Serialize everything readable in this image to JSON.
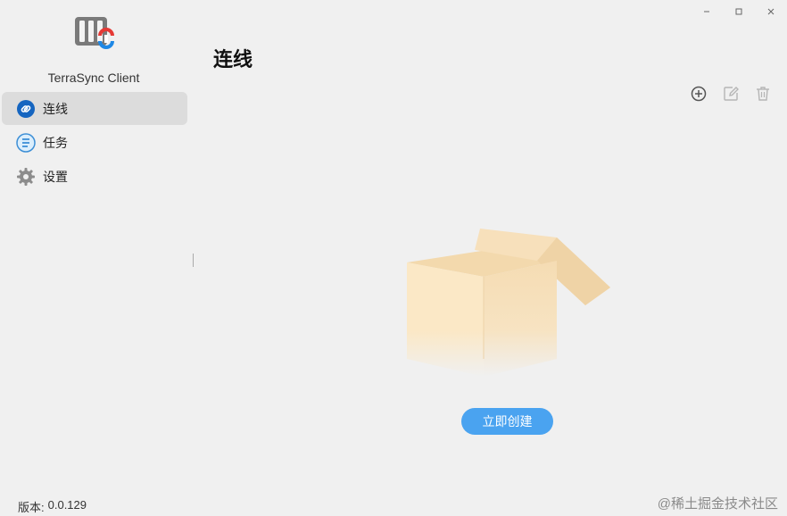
{
  "app": {
    "name": "TerraSync Client"
  },
  "window_controls": [
    {
      "name": "minimize",
      "icon": "minimize-icon"
    },
    {
      "name": "maximize",
      "icon": "maximize-icon"
    },
    {
      "name": "close",
      "icon": "close-icon"
    }
  ],
  "sidebar": {
    "items": [
      {
        "label": "连线",
        "icon": "link-icon",
        "active": true
      },
      {
        "label": "任务",
        "icon": "task-list-icon",
        "active": false
      },
      {
        "label": "设置",
        "icon": "gear-icon",
        "active": false
      }
    ],
    "version_label": "版本:",
    "version_value": "0.0.129"
  },
  "main": {
    "title": "连线",
    "toolbar": [
      {
        "name": "add",
        "icon": "add-circle-icon"
      },
      {
        "name": "edit",
        "icon": "edit-icon"
      },
      {
        "name": "delete",
        "icon": "trash-icon"
      }
    ],
    "empty_state": {
      "illustration": "empty-box-icon",
      "create_label": "立即创建"
    }
  },
  "watermark": "@稀土掘金技术社区",
  "colors": {
    "background": "#f0f0f0",
    "sidebar_active": "#dcdcdc",
    "primary_button": "#4aa3f0",
    "link_icon": "#1565c0",
    "logo_accent_red": "#e53935",
    "logo_accent_blue": "#1e88e5"
  }
}
